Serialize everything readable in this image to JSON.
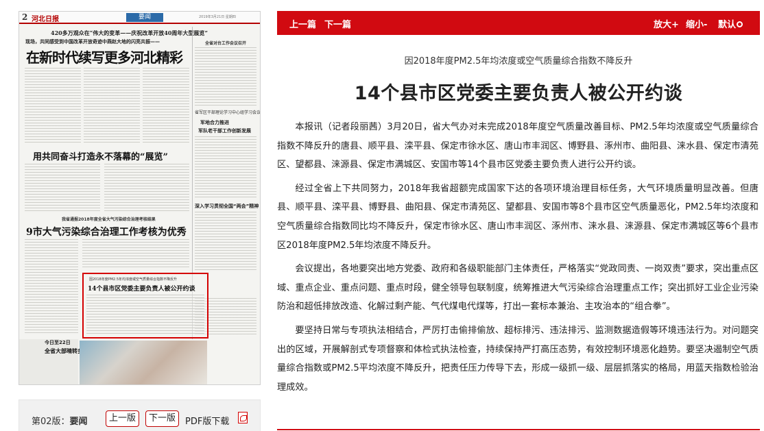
{
  "newspaper": {
    "page_number": "2",
    "logo": "河北日报",
    "section": "要闻",
    "date_line": "2019年3月21日 星期四",
    "kicker1": "420多万观众在“伟大的变革——庆祝改革开放40周年大型展览”",
    "kicker2": "现场，共同感受到中国改革开放奇迹中燕赵大地的闪亮共振——",
    "headline1": "在新时代续写更多河北精彩",
    "right_col_title": "全省对台工作会议召开",
    "side1": "省军区干部理论学习中心组学习会议",
    "side2": "军地合力推进",
    "side3": "军队老干部工作创新发展",
    "headline2": "用共同奋斗打造永不落幕的“展览”",
    "side4": "深入学习贯彻全国“两会”精神",
    "kicker3": "我省通报2018年度全省大气污染综合治理考核结果",
    "headline3": "9市大气污染综合治理工作考核为优秀",
    "highlight_kicker": "因2018年度PM2.5年均浓度或空气质量综合指数不降反升",
    "highlight_title": "14个县市区党委主要负责人被公开约谈",
    "weather1": "今日至22日",
    "weather2": "全省大部晴转多云"
  },
  "page_nav": {
    "label_prefix": "第02版：",
    "label_section": "要闻",
    "prev_page": "上一版",
    "next_page": "下一版",
    "pdf_download": "PDF版下载",
    "pdf_icon": "pdf-icon"
  },
  "top_bar": {
    "prev_article": "上一篇",
    "next_article": "下一篇",
    "zoom_in": "放大+",
    "zoom_out": "缩小-",
    "zoom_default": "默认",
    "bar_color": "#d10a11"
  },
  "article": {
    "kicker": "因2018年度PM2.5年均浓度或空气质量综合指数不降反升",
    "title": "14个县市区党委主要负责人被公开约谈",
    "paragraphs": [
      "本报讯（记者段丽茜）3月20日，省大气办对未完成2018年度空气质量改善目标、PM2.5年均浓度或空气质量综合指数不降反升的唐县、顺平县、滦平县、保定市徐水区、唐山市丰润区、博野县、涿州市、曲阳县、涞水县、保定市清苑区、望都县、涞源县、保定市满城区、安国市等14个县市区党委主要负责人进行公开约谈。",
      "经过全省上下共同努力，2018年我省超额完成国家下达的各项环境治理目标任务，大气环境质量明显改善。但唐县、顺平县、滦平县、博野县、曲阳县、保定市清苑区、望都县、安国市等8个县市区空气质量恶化，PM2.5年均浓度和空气质量综合指数同比均不降反升，保定市徐水区、唐山市丰润区、涿州市、涞水县、涞源县、保定市满城区等6个县市区2018年度PM2.5年均浓度不降反升。",
      "会议提出，各地要突出地方党委、政府和各级职能部门主体责任，严格落实“党政同责、一岗双责”要求，突出重点区域、重点企业、重点问题、重点时段，健全领导包联制度，统筹推进大气污染综合治理重点工作；突出抓好工业企业污染防治和超低排放改造、化解过剩产能、气代煤电代煤等，打出一套标本兼治、主攻治本的“组合拳”。",
      "要坚持日常与专项执法相结合，严厉打击偷排偷放、超标排污、违法排污、监测数据造假等环境违法行为。对问题突出的区域，开展解剖式专项督察和体检式执法检查，持续保持严打高压态势，有效控制环境恶化趋势。要坚决遏制空气质量综合指数或PM2.5平均浓度不降反升，把责任压力传导下去，形成一级抓一级、层层抓落实的格局，用蓝天指数检验治理成效。"
    ]
  }
}
